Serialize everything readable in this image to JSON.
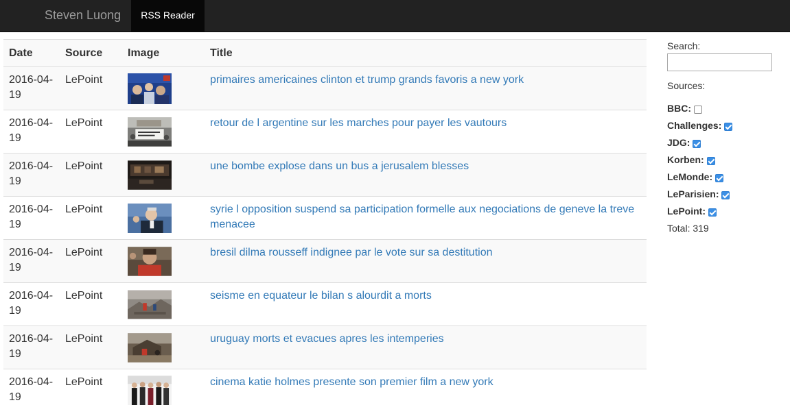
{
  "nav": {
    "brand": "Steven Luong",
    "active_tab": "RSS Reader"
  },
  "table": {
    "headers": {
      "date": "Date",
      "source": "Source",
      "image": "Image",
      "title": "Title"
    },
    "rows": [
      {
        "date": "2016-04-19",
        "source": "LePoint",
        "image": "protest-crowd-photo",
        "title": "primaires americaines clinton et trump grands favoris a new york"
      },
      {
        "date": "2016-04-19",
        "source": "LePoint",
        "image": "argentina-banner-photo",
        "title": "retour de l argentine sur les marches pour payer les vautours"
      },
      {
        "date": "2016-04-19",
        "source": "LePoint",
        "image": "bus-wreck-photo",
        "title": "une bombe explose dans un bus a jerusalem blesses"
      },
      {
        "date": "2016-04-19",
        "source": "LePoint",
        "image": "diplomat-portrait-photo",
        "title": "syrie l opposition suspend sa participation formelle aux negociations de geneve la treve menacee"
      },
      {
        "date": "2016-04-19",
        "source": "LePoint",
        "image": "dilma-rousseff-photo",
        "title": "bresil dilma rousseff indignee par le vote sur sa destitution"
      },
      {
        "date": "2016-04-19",
        "source": "LePoint",
        "image": "earthquake-rubble-photo",
        "title": "seisme en equateur le bilan s alourdit a morts"
      },
      {
        "date": "2016-04-19",
        "source": "LePoint",
        "image": "flood-damage-photo",
        "title": "uruguay morts et evacues apres les intemperies"
      },
      {
        "date": "2016-04-19",
        "source": "LePoint",
        "image": "premiere-group-photo",
        "title": "cinema katie holmes presente son premier film a new york"
      }
    ]
  },
  "sidebar": {
    "search_label": "Search:",
    "search_value": "",
    "sources_label": "Sources:",
    "sources": [
      {
        "label": "BBC:",
        "checked": false
      },
      {
        "label": "Challenges:",
        "checked": true
      },
      {
        "label": "JDG:",
        "checked": true
      },
      {
        "label": "Korben:",
        "checked": true
      },
      {
        "label": "LeMonde:",
        "checked": true
      },
      {
        "label": "LeParisien:",
        "checked": true
      },
      {
        "label": "LePoint:",
        "checked": true
      }
    ],
    "total": "Total: 319"
  },
  "colors": {
    "navbar": "#222222",
    "link": "#337ab7",
    "checkbox": "#3b8fe5"
  }
}
